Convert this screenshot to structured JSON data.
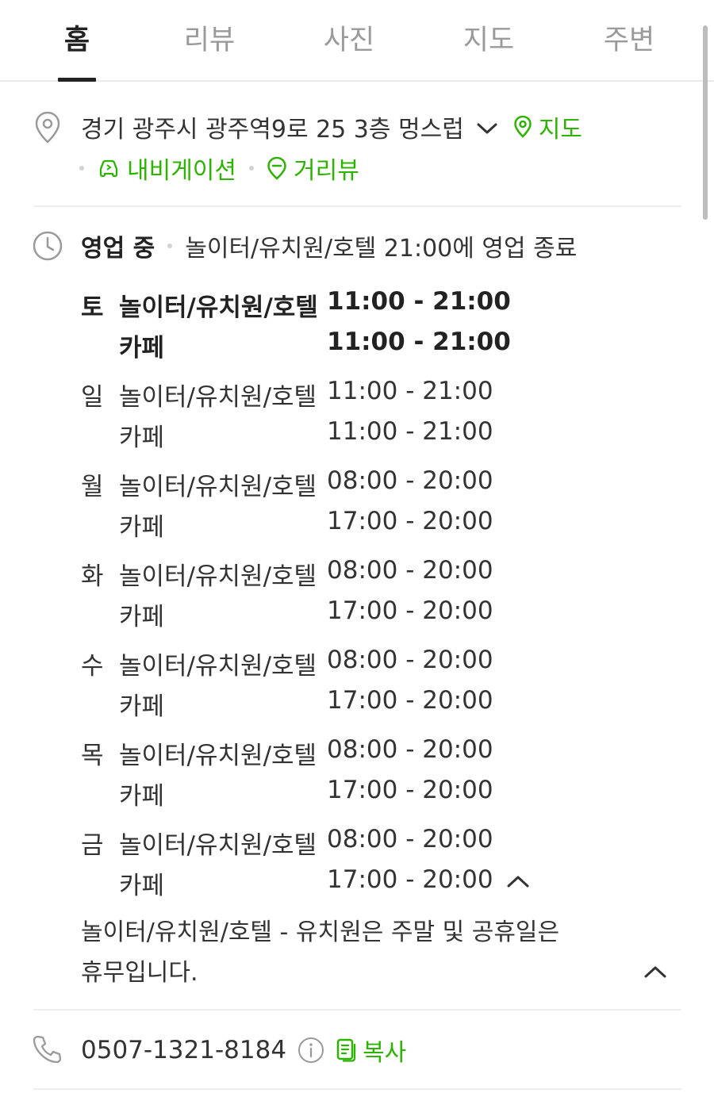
{
  "tabs": [
    {
      "label": "홈",
      "active": true
    },
    {
      "label": "리뷰",
      "active": false
    },
    {
      "label": "사진",
      "active": false
    },
    {
      "label": "지도",
      "active": false
    },
    {
      "label": "주변",
      "active": false
    }
  ],
  "address": {
    "text": "경기 광주시 광주역9로 25 3층 멍스럽",
    "map_label": "지도",
    "navigation_label": "내비게이션",
    "streetview_label": "거리뷰"
  },
  "hours": {
    "status": "영업 중",
    "status_desc": "놀이터/유치원/호텔 21:00에 영업 종료",
    "days": [
      {
        "day": "토",
        "today": true,
        "entries": [
          {
            "category": "놀이터/유치원/호텔",
            "time": "11:00 - 21:00"
          },
          {
            "category": "카페",
            "time": "11:00 - 21:00"
          }
        ]
      },
      {
        "day": "일",
        "today": false,
        "entries": [
          {
            "category": "놀이터/유치원/호텔",
            "time": "11:00 - 21:00"
          },
          {
            "category": "카페",
            "time": "11:00 - 21:00"
          }
        ]
      },
      {
        "day": "월",
        "today": false,
        "entries": [
          {
            "category": "놀이터/유치원/호텔",
            "time": "08:00 - 20:00"
          },
          {
            "category": "카페",
            "time": "17:00 - 20:00"
          }
        ]
      },
      {
        "day": "화",
        "today": false,
        "entries": [
          {
            "category": "놀이터/유치원/호텔",
            "time": "08:00 - 20:00"
          },
          {
            "category": "카페",
            "time": "17:00 - 20:00"
          }
        ]
      },
      {
        "day": "수",
        "today": false,
        "entries": [
          {
            "category": "놀이터/유치원/호텔",
            "time": "08:00 - 20:00"
          },
          {
            "category": "카페",
            "time": "17:00 - 20:00"
          }
        ]
      },
      {
        "day": "목",
        "today": false,
        "entries": [
          {
            "category": "놀이터/유치원/호텔",
            "time": "08:00 - 20:00"
          },
          {
            "category": "카페",
            "time": "17:00 - 20:00"
          }
        ]
      },
      {
        "day": "금",
        "today": false,
        "entries": [
          {
            "category": "놀이터/유치원/호텔",
            "time": "08:00 - 20:00"
          },
          {
            "category": "카페",
            "time": "17:00 - 20:00"
          }
        ]
      }
    ],
    "note_line1": "놀이터/유치원/호텔 - 유치원은 주말 및 공휴일은",
    "note_line2": "휴무입니다."
  },
  "phone": {
    "number": "0507-1321-8184",
    "copy_label": "복사"
  },
  "colors": {
    "accent_green": "#2db400",
    "text_primary": "#333333",
    "tab_inactive": "#9a9a9a"
  },
  "icons": [
    "location-pin-icon",
    "chevron-down-icon",
    "map-pin-icon",
    "car-navigation-icon",
    "streetview-icon",
    "clock-icon",
    "chevron-up-icon",
    "phone-icon",
    "info-icon",
    "copy-icon"
  ]
}
